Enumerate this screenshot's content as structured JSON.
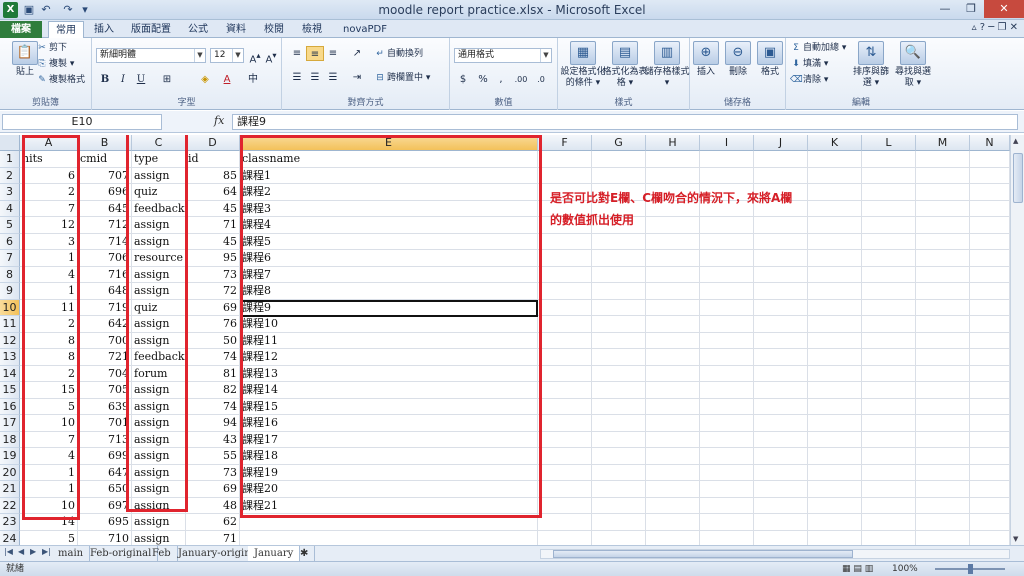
{
  "window": {
    "title": "moodle report practice.xlsx - Microsoft Excel",
    "app_icon": "X"
  },
  "ribbon_tabs": [
    "檔案",
    "常用",
    "插入",
    "版面配置",
    "公式",
    "資料",
    "校閱",
    "檢視",
    "novaPDF"
  ],
  "ribbon": {
    "clipboard": {
      "paste": "貼上",
      "cut": "剪下",
      "copy": "複製 ▾",
      "format_painter": "複製格式",
      "label": "剪貼簿"
    },
    "font": {
      "name": "新細明體",
      "size": "12",
      "label": "字型"
    },
    "alignment": {
      "wrap": "自動換列",
      "merge": "跨欄置中 ▾",
      "label": "對齊方式"
    },
    "number": {
      "format": "通用格式",
      "label": "數值"
    },
    "styles": {
      "cond": "設定格式化的條件 ▾",
      "table": "格式化為表格 ▾",
      "cellstyle": "儲存格樣式 ▾",
      "label": "樣式"
    },
    "cells": {
      "insert": "插入",
      "delete": "刪除",
      "format": "格式",
      "label": "儲存格"
    },
    "editing": {
      "autosum": "自動加總 ▾",
      "fill": "填滿 ▾",
      "clear": "清除 ▾",
      "sort": "排序與篩選 ▾",
      "find": "尋找與選取 ▾",
      "label": "編輯"
    }
  },
  "formula_bar": {
    "name_box": "E10",
    "fx": "fx",
    "content": "課程9"
  },
  "columns": [
    "A",
    "B",
    "C",
    "D",
    "E",
    "F",
    "G",
    "H",
    "I",
    "J",
    "K",
    "L",
    "M",
    "N"
  ],
  "rows": [
    {
      "n": "1",
      "a": "hits",
      "b": "cmid",
      "c": "type",
      "d": "id",
      "e": "classname"
    },
    {
      "n": "2",
      "a": "6",
      "b": "707",
      "c": "assign",
      "d": "85",
      "e": "課程1"
    },
    {
      "n": "3",
      "a": "2",
      "b": "696",
      "c": "quiz",
      "d": "64",
      "e": "課程2"
    },
    {
      "n": "4",
      "a": "7",
      "b": "645",
      "c": "feedback",
      "d": "45",
      "e": "課程3"
    },
    {
      "n": "5",
      "a": "12",
      "b": "712",
      "c": "assign",
      "d": "71",
      "e": "課程4"
    },
    {
      "n": "6",
      "a": "3",
      "b": "714",
      "c": "assign",
      "d": "45",
      "e": "課程5"
    },
    {
      "n": "7",
      "a": "1",
      "b": "706",
      "c": "resource",
      "d": "95",
      "e": "課程6"
    },
    {
      "n": "8",
      "a": "4",
      "b": "716",
      "c": "assign",
      "d": "73",
      "e": "課程7"
    },
    {
      "n": "9",
      "a": "1",
      "b": "648",
      "c": "assign",
      "d": "72",
      "e": "課程8"
    },
    {
      "n": "10",
      "a": "11",
      "b": "719",
      "c": "quiz",
      "d": "69",
      "e": "課程9"
    },
    {
      "n": "11",
      "a": "2",
      "b": "642",
      "c": "assign",
      "d": "76",
      "e": "課程10"
    },
    {
      "n": "12",
      "a": "8",
      "b": "700",
      "c": "assign",
      "d": "50",
      "e": "課程11"
    },
    {
      "n": "13",
      "a": "8",
      "b": "721",
      "c": "feedback",
      "d": "74",
      "e": "課程12"
    },
    {
      "n": "14",
      "a": "2",
      "b": "704",
      "c": "forum",
      "d": "81",
      "e": "課程13"
    },
    {
      "n": "15",
      "a": "15",
      "b": "705",
      "c": "assign",
      "d": "82",
      "e": "課程14"
    },
    {
      "n": "16",
      "a": "5",
      "b": "639",
      "c": "assign",
      "d": "74",
      "e": "課程15"
    },
    {
      "n": "17",
      "a": "10",
      "b": "701",
      "c": "assign",
      "d": "94",
      "e": "課程16"
    },
    {
      "n": "18",
      "a": "7",
      "b": "713",
      "c": "assign",
      "d": "43",
      "e": "課程17"
    },
    {
      "n": "19",
      "a": "4",
      "b": "699",
      "c": "assign",
      "d": "55",
      "e": "課程18"
    },
    {
      "n": "20",
      "a": "1",
      "b": "647",
      "c": "assign",
      "d": "73",
      "e": "課程19"
    },
    {
      "n": "21",
      "a": "1",
      "b": "650",
      "c": "assign",
      "d": "69",
      "e": "課程20"
    },
    {
      "n": "22",
      "a": "10",
      "b": "697",
      "c": "assign",
      "d": "48",
      "e": "課程21"
    },
    {
      "n": "23",
      "a": "14",
      "b": "695",
      "c": "assign",
      "d": "62",
      "e": ""
    },
    {
      "n": "24",
      "a": "5",
      "b": "710",
      "c": "assign",
      "d": "71",
      "e": ""
    }
  ],
  "annotation": {
    "line1": "是否可比對E欄、C欄吻合的情況下，來將A欄",
    "line2": "的數值抓出使用"
  },
  "sheet_tabs": [
    "main",
    "Feb-original",
    "Feb",
    "January-original",
    "January"
  ],
  "active_sheet": "January",
  "status": {
    "ready": "就緒",
    "zoom": "100%"
  },
  "colors": {
    "annotation_red": "#e0242e",
    "excel_green": "#2f7d3c"
  }
}
